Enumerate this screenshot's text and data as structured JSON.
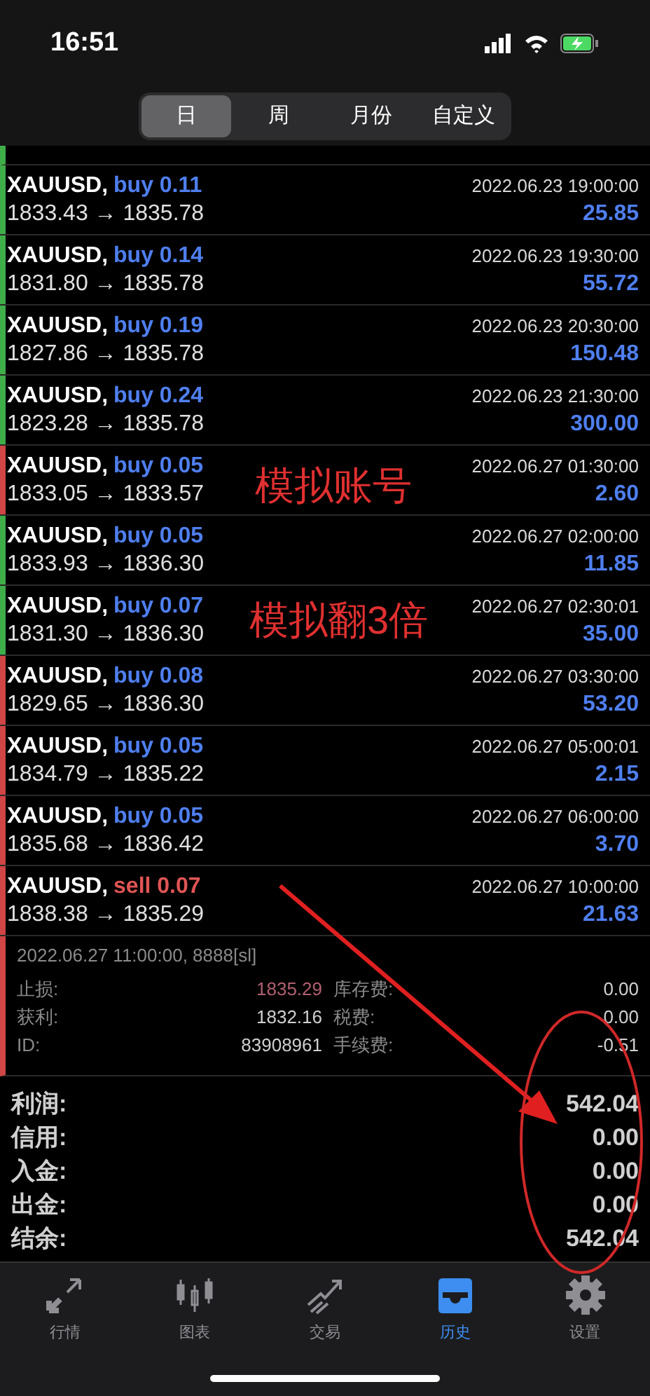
{
  "status_bar": {
    "time": "16:51"
  },
  "period_tabs": [
    {
      "label": "日",
      "selected": true
    },
    {
      "label": "周",
      "selected": false
    },
    {
      "label": "月份",
      "selected": false
    },
    {
      "label": "自定义",
      "selected": false
    }
  ],
  "deals": [
    {
      "symbol": "XAUUSD,",
      "kind": "buy",
      "action": "buy 0.11",
      "time": "2022.06.23 19:00:00",
      "prices": "1833.43 → 1835.78",
      "profit": "25.85",
      "color": "#3fae49"
    },
    {
      "symbol": "XAUUSD,",
      "kind": "buy",
      "action": "buy 0.14",
      "time": "2022.06.23 19:30:00",
      "prices": "1831.80 → 1835.78",
      "profit": "55.72",
      "color": "#3fae49"
    },
    {
      "symbol": "XAUUSD,",
      "kind": "buy",
      "action": "buy 0.19",
      "time": "2022.06.23 20:30:00",
      "prices": "1827.86 → 1835.78",
      "profit": "150.48",
      "color": "#3fae49"
    },
    {
      "symbol": "XAUUSD,",
      "kind": "buy",
      "action": "buy 0.24",
      "time": "2022.06.23 21:30:00",
      "prices": "1823.28 → 1835.78",
      "profit": "300.00",
      "color": "#3fae49"
    },
    {
      "symbol": "XAUUSD,",
      "kind": "buy",
      "action": "buy 0.05",
      "time": "2022.06.27 01:30:00",
      "prices": "1833.05 → 1833.57",
      "profit": "2.60",
      "color": "#d04545"
    },
    {
      "symbol": "XAUUSD,",
      "kind": "buy",
      "action": "buy 0.05",
      "time": "2022.06.27 02:00:00",
      "prices": "1833.93 → 1836.30",
      "profit": "11.85",
      "color": "#3fae49"
    },
    {
      "symbol": "XAUUSD,",
      "kind": "buy",
      "action": "buy 0.07",
      "time": "2022.06.27 02:30:01",
      "prices": "1831.30 → 1836.30",
      "profit": "35.00",
      "color": "#3fae49"
    },
    {
      "symbol": "XAUUSD,",
      "kind": "buy",
      "action": "buy 0.08",
      "time": "2022.06.27 03:30:00",
      "prices": "1829.65 → 1836.30",
      "profit": "53.20",
      "color": "#d04545"
    },
    {
      "symbol": "XAUUSD,",
      "kind": "buy",
      "action": "buy 0.05",
      "time": "2022.06.27 05:00:01",
      "prices": "1834.79 → 1835.22",
      "profit": "2.15",
      "color": "#d04545"
    },
    {
      "symbol": "XAUUSD,",
      "kind": "buy",
      "action": "buy 0.05",
      "time": "2022.06.27 06:00:00",
      "prices": "1835.68 → 1836.42",
      "profit": "3.70",
      "color": "#d04545"
    },
    {
      "symbol": "XAUUSD,",
      "kind": "sell",
      "action": "sell 0.07",
      "time": "2022.06.27 10:00:00",
      "prices": "1838.38 → 1835.29",
      "profit": "21.63",
      "color": "#d04545"
    }
  ],
  "deal_detail": {
    "close_info": "2022.06.27 11:00:00, 8888[sl]",
    "fields": [
      {
        "label": "止损:",
        "value": "1835.29",
        "kind": "loss"
      },
      {
        "label": "库存费:",
        "value": "0.00",
        "kind": "plain"
      },
      {
        "label": "获利:",
        "value": "1832.16",
        "kind": "plain"
      },
      {
        "label": "税费:",
        "value": "0.00",
        "kind": "plain"
      },
      {
        "label": "ID:",
        "value": "83908961",
        "kind": "plain"
      },
      {
        "label": "手续费:",
        "value": "-0.51",
        "kind": "plain"
      }
    ]
  },
  "summary": [
    {
      "label": "利润:",
      "value": "542.04"
    },
    {
      "label": "信用:",
      "value": "0.00"
    },
    {
      "label": "入金:",
      "value": "0.00"
    },
    {
      "label": "出金:",
      "value": "0.00"
    },
    {
      "label": "结余:",
      "value": "542.04"
    }
  ],
  "annotations": [
    {
      "text": "模拟账号"
    },
    {
      "text": "模拟翻3倍"
    }
  ],
  "bottom_tabs": [
    {
      "label": "行情",
      "kind": "arrows",
      "selected": false
    },
    {
      "label": "图表",
      "kind": "candles",
      "selected": false
    },
    {
      "label": "交易",
      "kind": "trend",
      "selected": false
    },
    {
      "label": "历史",
      "kind": "inbox",
      "selected": true
    },
    {
      "label": "设置",
      "kind": "gear",
      "selected": false
    }
  ]
}
